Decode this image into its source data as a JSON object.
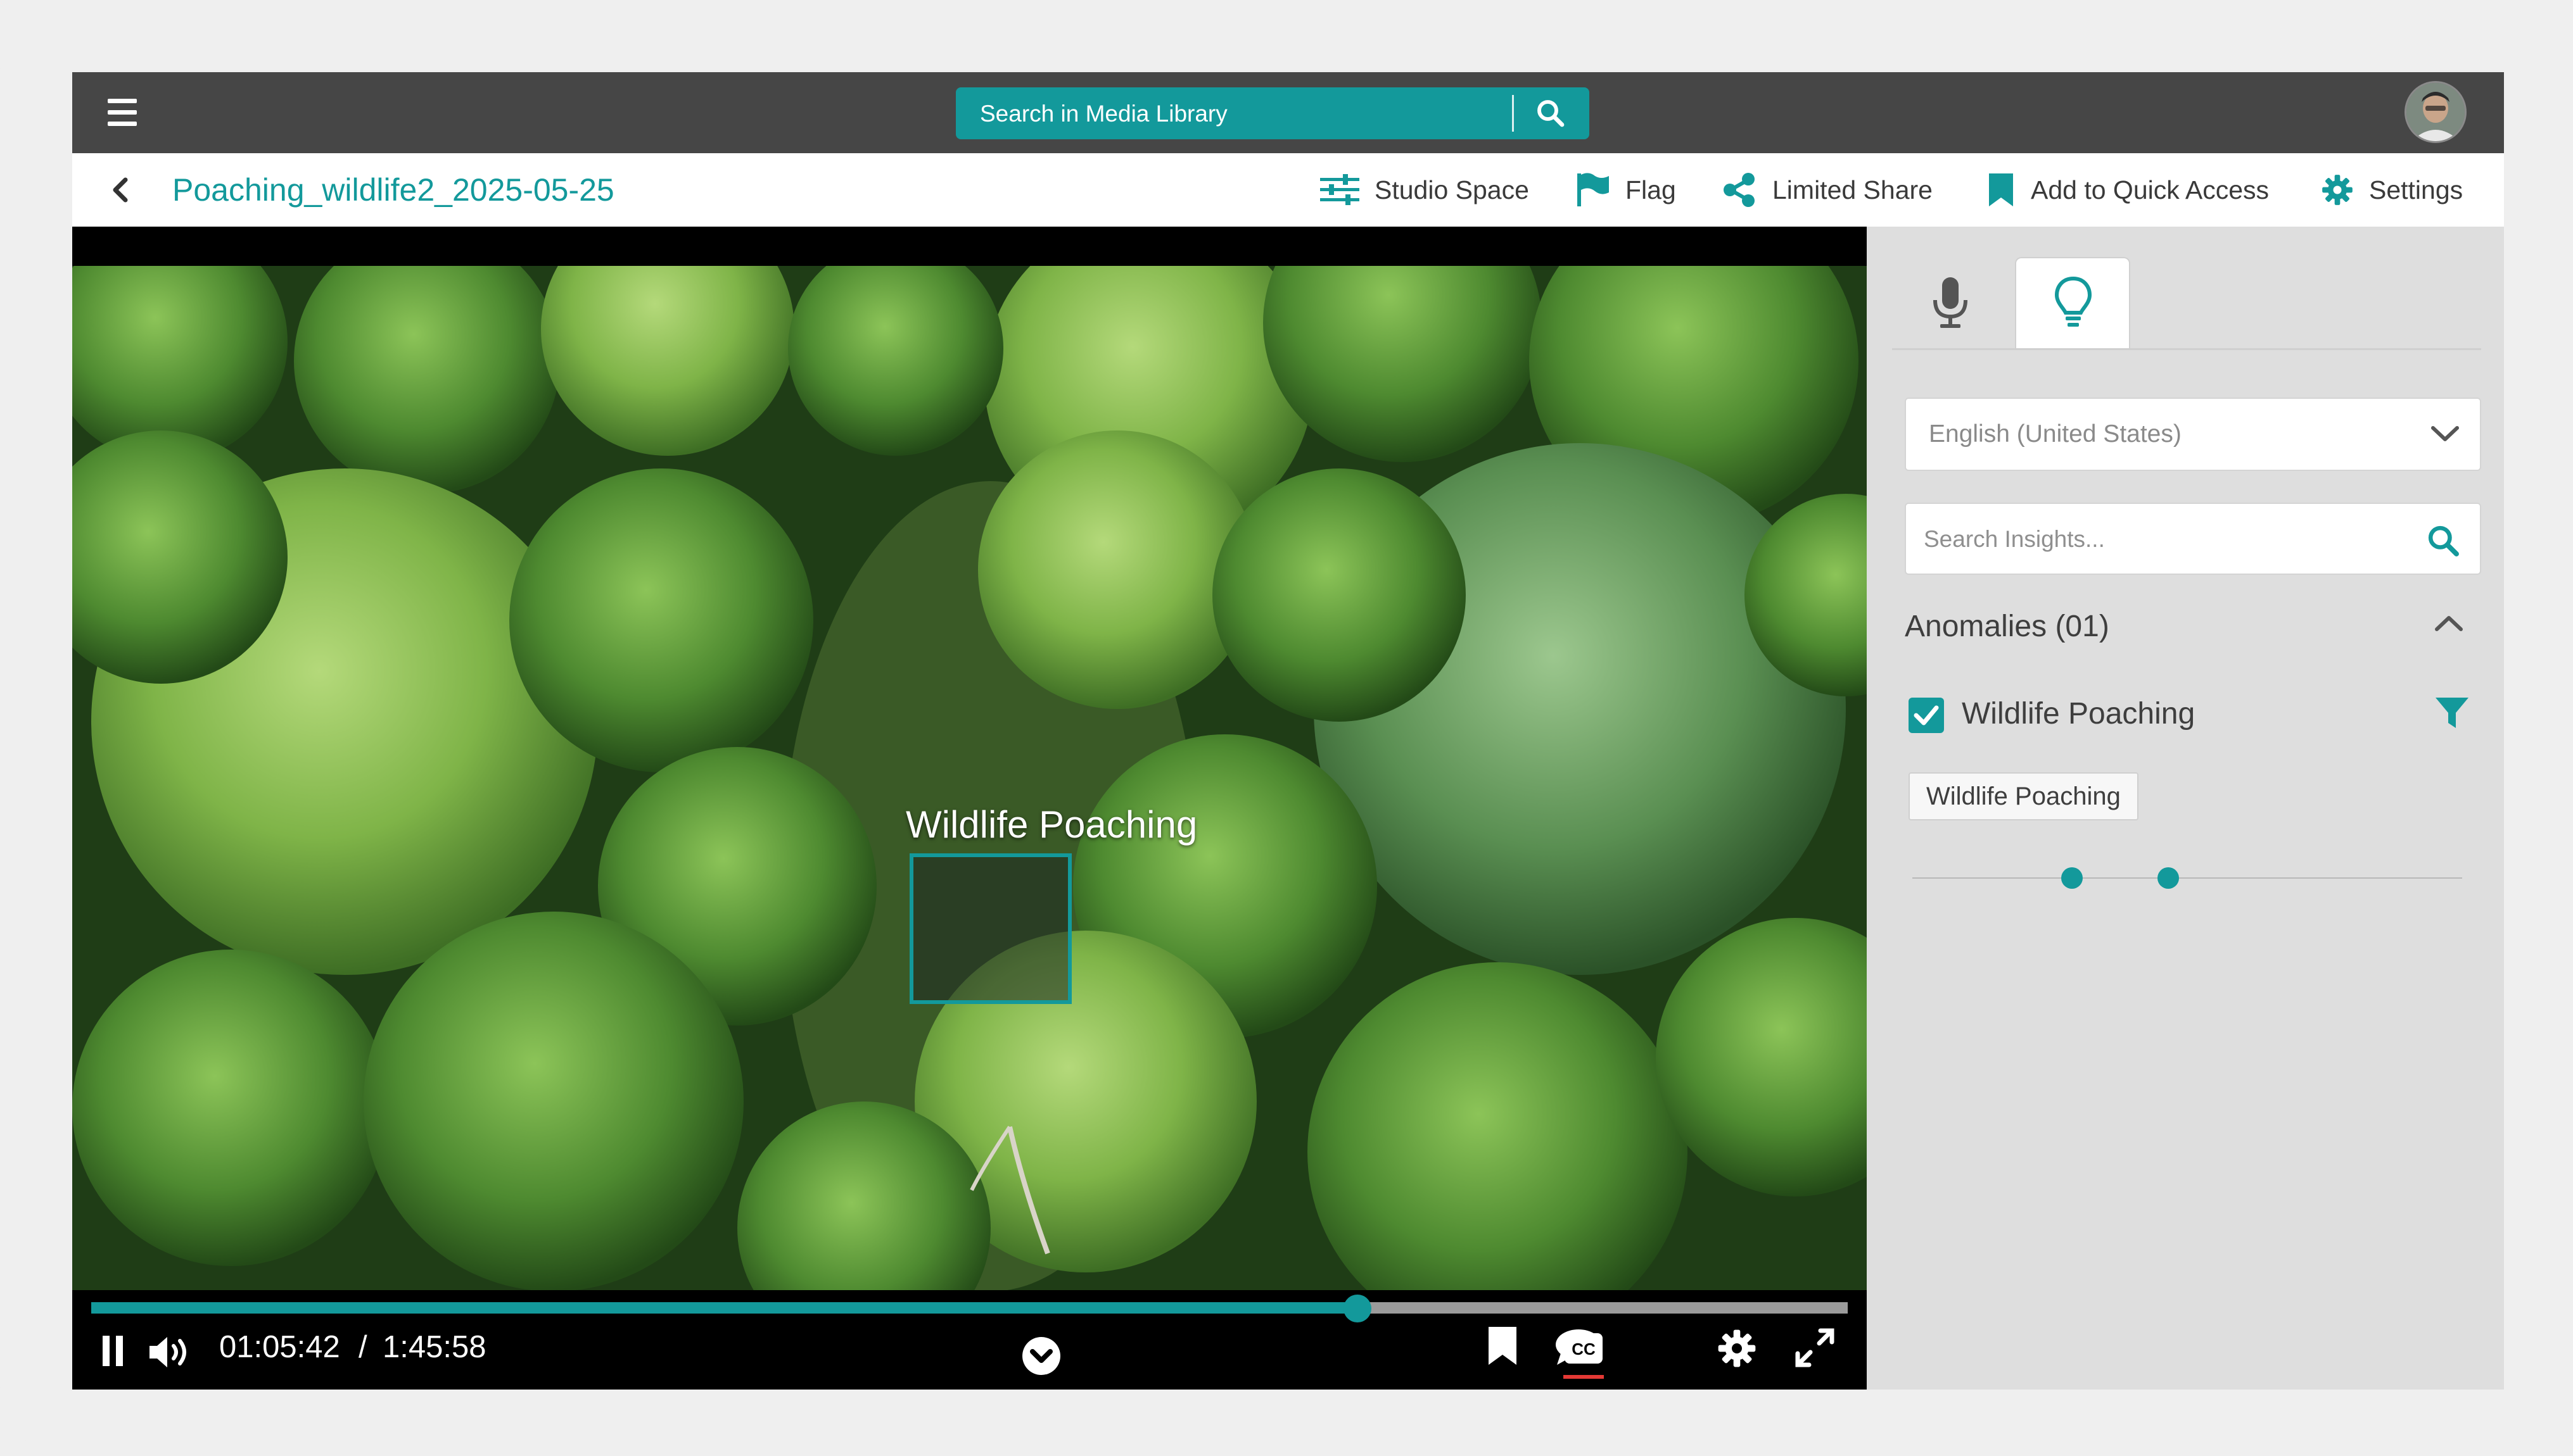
{
  "colors": {
    "accent": "#13999b",
    "topbar": "#464646",
    "panel": "#dedede"
  },
  "topbar": {
    "search_placeholder": "Search in Media Library",
    "menu_icon": "hamburger-menu-icon",
    "search_icon": "search-icon"
  },
  "header": {
    "title": "Poaching_wildlife2_2025-05-25",
    "actions": [
      {
        "label": "Studio Space",
        "icon": "sliders-icon"
      },
      {
        "label": "Flag",
        "icon": "flag-icon"
      },
      {
        "label": "Limited Share",
        "icon": "share-icon"
      },
      {
        "label": "Add to Quick Access",
        "icon": "bookmark-icon"
      },
      {
        "label": "Settings",
        "icon": "gear-icon"
      }
    ]
  },
  "video": {
    "detection_label": "Wildlife Poaching",
    "current_time": "01:05:42",
    "separator": "/",
    "total_time": "1:45:58",
    "progress": 0.721
  },
  "panel": {
    "tabs": [
      {
        "icon": "microphone-icon",
        "active": false
      },
      {
        "icon": "lightbulb-icon",
        "active": true
      }
    ],
    "language": "English (United States)",
    "search_placeholder": "Search Insights...",
    "anomalies_title": "Anomalies (01)",
    "anomaly": {
      "label": "Wildlife Poaching",
      "checked": true,
      "tag": "Wildlife Poaching"
    },
    "timeline_markers": [
      0.29,
      0.465
    ]
  }
}
